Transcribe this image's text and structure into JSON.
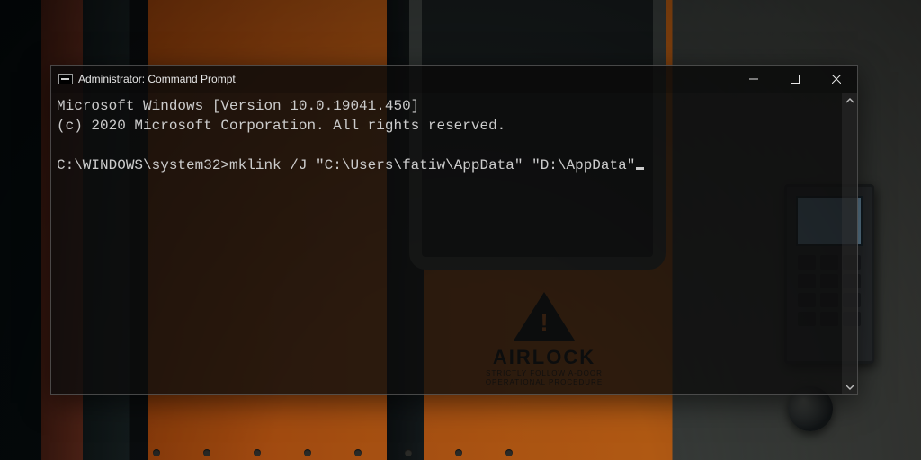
{
  "wallpaper": {
    "sign_title": "AIRLOCK",
    "sign_sub1": "STRICTLY FOLLOW A-DOOR",
    "sign_sub2": "OPERATIONAL PROCEDURE"
  },
  "window": {
    "title": "Administrator: Command Prompt",
    "controls": {
      "minimize": "Minimize",
      "maximize": "Maximize",
      "close": "Close"
    }
  },
  "console": {
    "line1": "Microsoft Windows [Version 10.0.19041.450]",
    "line2": "(c) 2020 Microsoft Corporation. All rights reserved.",
    "blank": "",
    "prompt": "C:\\WINDOWS\\system32>",
    "command": "mklink /J \"C:\\Users\\fatiw\\AppData\" \"D:\\AppData\""
  }
}
